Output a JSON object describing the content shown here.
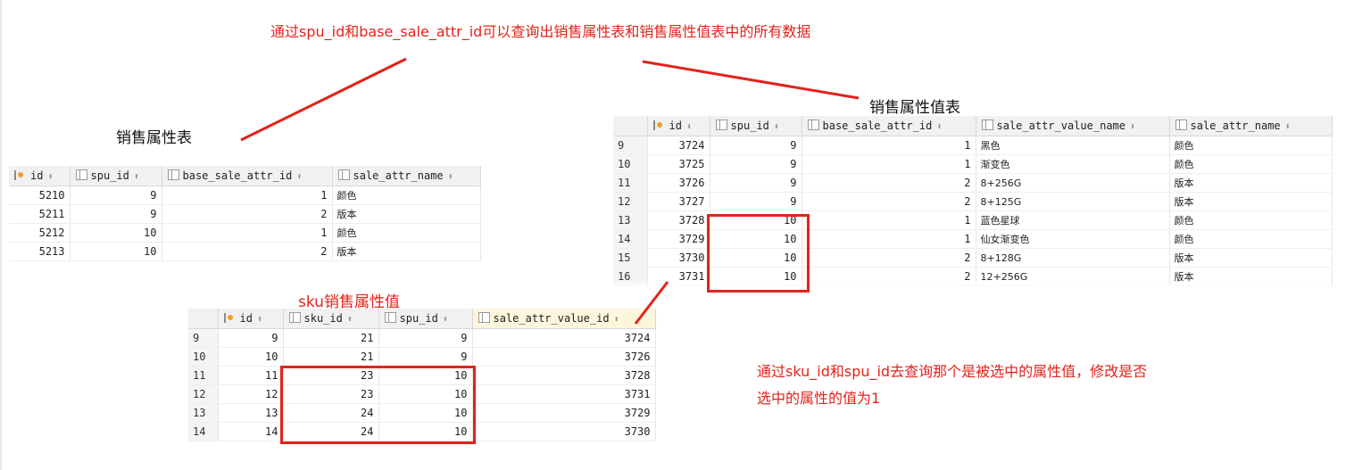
{
  "annotations": {
    "top": "通过spu_id和base_sale_attr_id可以查询出销售属性表和销售属性值表中的所有数据",
    "sku_title": "sku销售属性值",
    "right_line1": "通过sku_id和spu_id去查询那个是被选中的属性值，修改是否",
    "right_line2": "选中的属性的值为1"
  },
  "captions": {
    "sale_attr": "销售属性表",
    "sale_attr_value": "销售属性值表"
  },
  "colors": {
    "annotation": "#e2231a",
    "header_bg": "#f1f1f1",
    "highlight_header": "#fbf6dc"
  },
  "icons": {
    "key_column": "key-icon",
    "column": "column-icon",
    "sort": "sort-icon"
  },
  "sale_attr_table": {
    "columns": [
      "id",
      "spu_id",
      "base_sale_attr_id",
      "sale_attr_name"
    ],
    "sort_glyph": "⬍",
    "rows": [
      [
        "5210",
        "9",
        "1",
        "颜色"
      ],
      [
        "5211",
        "9",
        "2",
        "版本"
      ],
      [
        "5212",
        "10",
        "1",
        "颜色"
      ],
      [
        "5213",
        "10",
        "2",
        "版本"
      ]
    ]
  },
  "sale_attr_value_table": {
    "columns": [
      "id",
      "spu_id",
      "base_sale_attr_id",
      "sale_attr_value_name",
      "sale_attr_name"
    ],
    "rows": [
      [
        "9",
        "3724",
        "9",
        "1",
        "黑色",
        "颜色"
      ],
      [
        "10",
        "3725",
        "9",
        "1",
        "渐变色",
        "颜色"
      ],
      [
        "11",
        "3726",
        "9",
        "2",
        "8+256G",
        "版本"
      ],
      [
        "12",
        "3727",
        "9",
        "2",
        "8+125G",
        "版本"
      ],
      [
        "13",
        "3728",
        "10",
        "1",
        "蓝色星球",
        "颜色"
      ],
      [
        "14",
        "3729",
        "10",
        "1",
        "仙女渐变色",
        "颜色"
      ],
      [
        "15",
        "3730",
        "10",
        "2",
        "8+128G",
        "版本"
      ],
      [
        "16",
        "3731",
        "10",
        "2",
        "12+256G",
        "版本"
      ]
    ]
  },
  "sku_sale_attr_value_table": {
    "columns": [
      "id",
      "sku_id",
      "spu_id",
      "sale_attr_value_id"
    ],
    "rows": [
      [
        "9",
        "9",
        "21",
        "9",
        "3724"
      ],
      [
        "10",
        "10",
        "21",
        "9",
        "3726"
      ],
      [
        "11",
        "11",
        "23",
        "10",
        "3728"
      ],
      [
        "12",
        "12",
        "23",
        "10",
        "3731"
      ],
      [
        "13",
        "13",
        "24",
        "10",
        "3729"
      ],
      [
        "14",
        "14",
        "24",
        "10",
        "3730"
      ]
    ]
  }
}
